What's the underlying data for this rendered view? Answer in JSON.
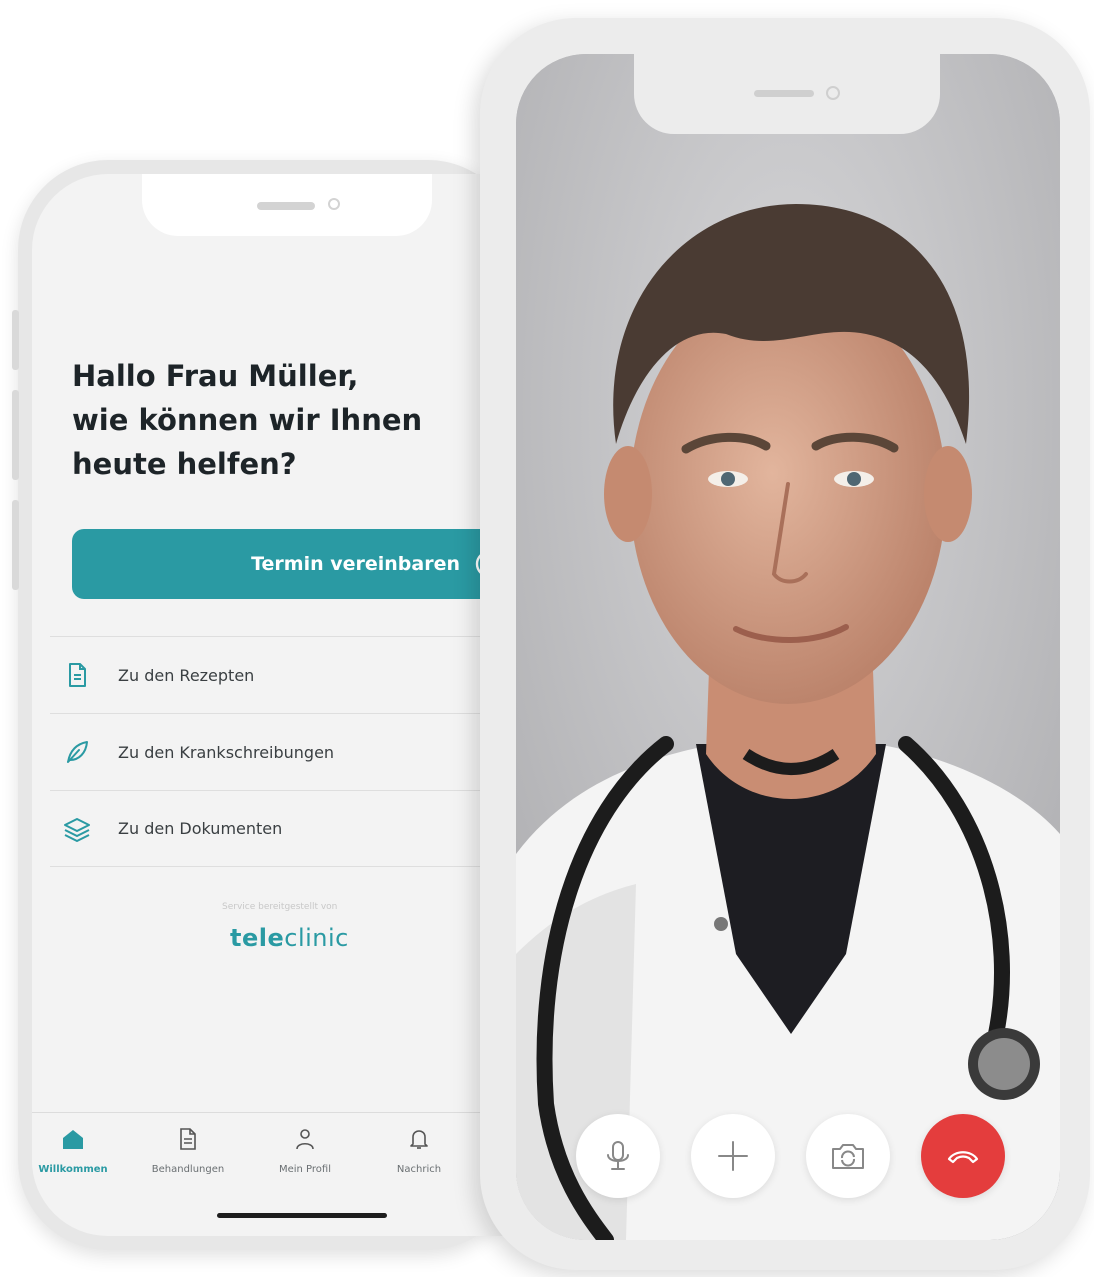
{
  "app_screen": {
    "greeting_lines": [
      "Hallo Frau Müller,",
      "wie können wir Ihnen",
      "heute helfen?"
    ],
    "cta": {
      "label": "Termin vereinbaren",
      "icon": "clock-icon"
    },
    "menu": [
      {
        "label": "Zu den Rezepten",
        "icon": "document-icon"
      },
      {
        "label": "Zu den Krankschreibungen",
        "icon": "leaf-icon"
      },
      {
        "label": "Zu den Dokumenten",
        "icon": "layers-icon"
      }
    ],
    "service_note": "Service bereitgestellt von",
    "brand": {
      "bold": "tele",
      "regular": "clinic"
    },
    "tabs": [
      {
        "label": "Willkommen",
        "icon": "home-icon",
        "active": true
      },
      {
        "label": "Behandlungen",
        "icon": "document-icon",
        "active": false
      },
      {
        "label": "Mein Profil",
        "icon": "person-icon",
        "active": false
      },
      {
        "label": "Nachrich",
        "icon": "bell-icon",
        "active": false
      }
    ]
  },
  "video_call": {
    "controls": [
      {
        "name": "microphone",
        "icon": "microphone-icon"
      },
      {
        "name": "add",
        "icon": "plus-icon"
      },
      {
        "name": "switch-camera",
        "icon": "camera-rotate-icon"
      },
      {
        "name": "end-call",
        "icon": "phone-hangup-icon"
      }
    ]
  },
  "colors": {
    "brand_teal": "#2a9aa3",
    "end_call_red": "#e43d3d",
    "heading_text": "#1d2428"
  }
}
